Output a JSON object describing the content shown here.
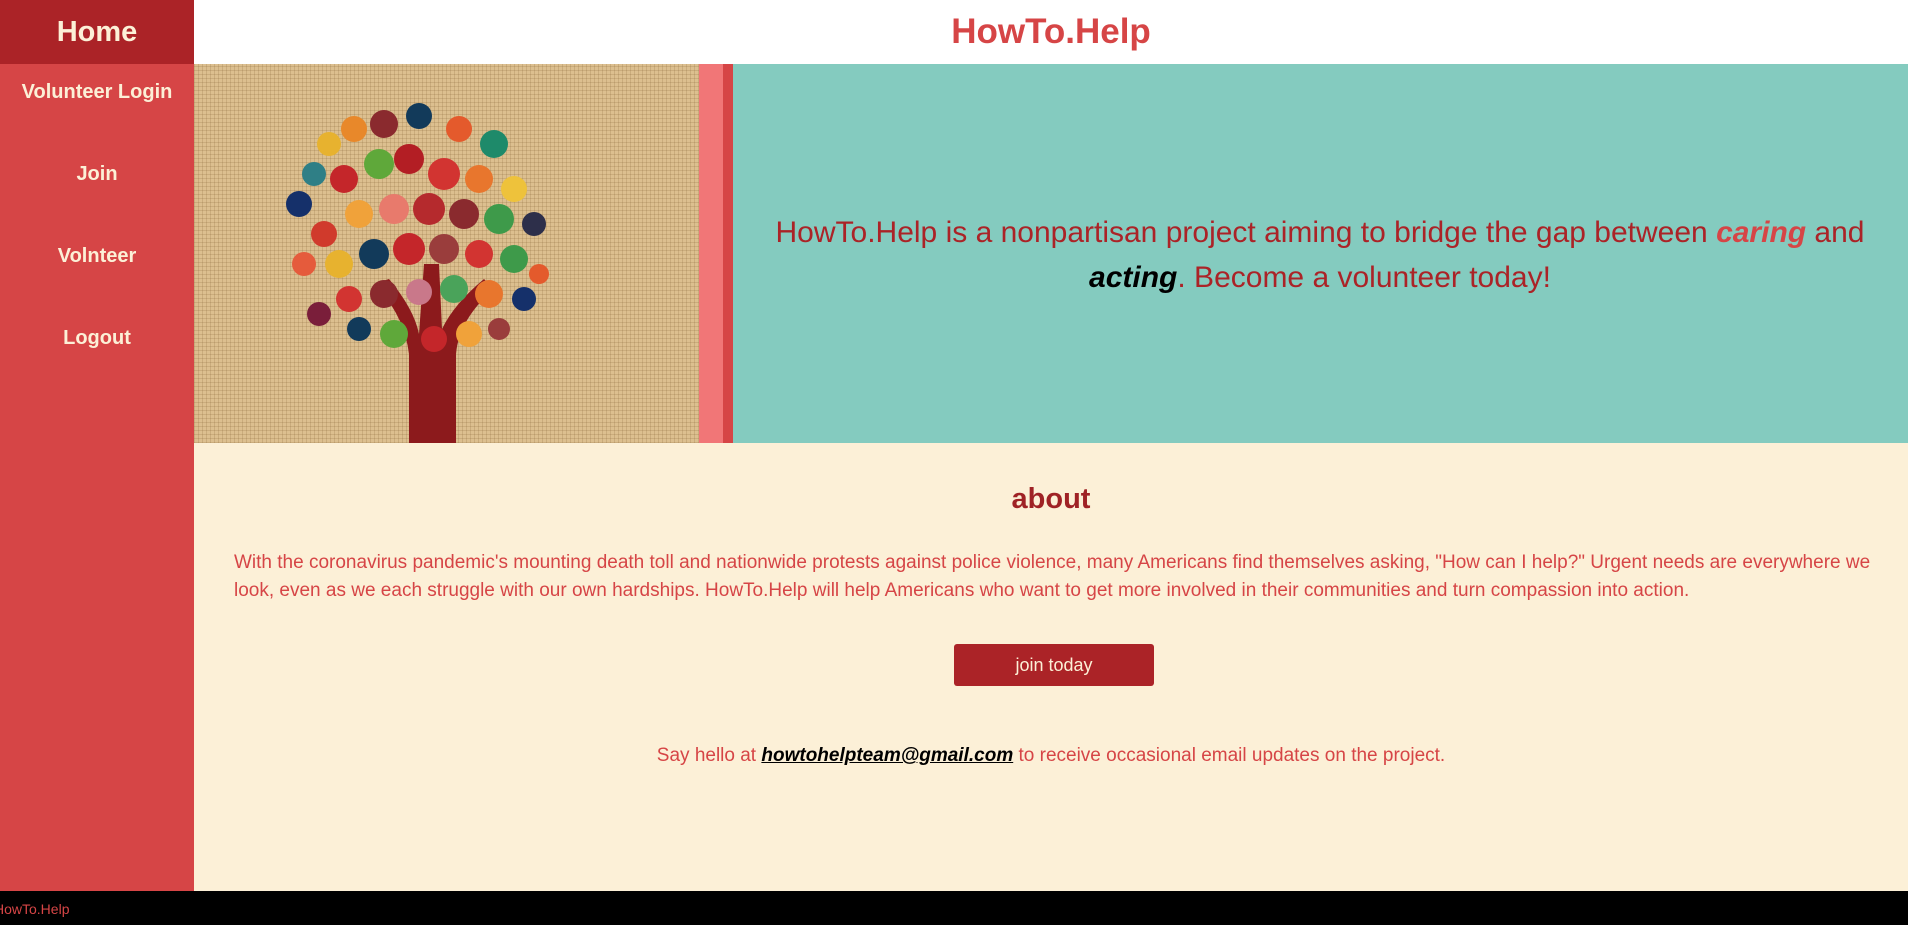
{
  "colors": {
    "brand_red": "#d64546",
    "dark_red": "#ab2327",
    "cream": "#fcf0d7",
    "teal": "#84cbbf",
    "pink_stripe": "#f17677"
  },
  "sidebar": {
    "home_label": "Home",
    "items": [
      {
        "label": "Volunteer Login"
      },
      {
        "label": "Join"
      },
      {
        "label": "Volnteer"
      },
      {
        "label": "Logout"
      }
    ]
  },
  "header": {
    "title": "HowTo.Help"
  },
  "hero": {
    "image_icon": "hands-tree-illustration",
    "text_before": "HowTo.Help is a nonpartisan project aiming to bridge the gap between ",
    "caring": "caring",
    "text_and": " and ",
    "acting": "acting",
    "text_after": ". Become a volunteer today!"
  },
  "about": {
    "heading": "about",
    "body": "With the coronavirus pandemic's mounting death toll and nationwide protests against police violence, many Americans find themselves asking, \"How can I help?\" Urgent needs are everywhere we look, even as we each struggle with our own hardships. HowTo.Help will help Americans who want to get more involved in their communities and turn compassion into action.",
    "button_label": "join today",
    "contact_prefix": "Say hello at ",
    "email": "howtohelpteam@gmail.com",
    "contact_suffix": " to receive occasional email updates on the project."
  },
  "footer": {
    "text": "HowTo.Help"
  }
}
